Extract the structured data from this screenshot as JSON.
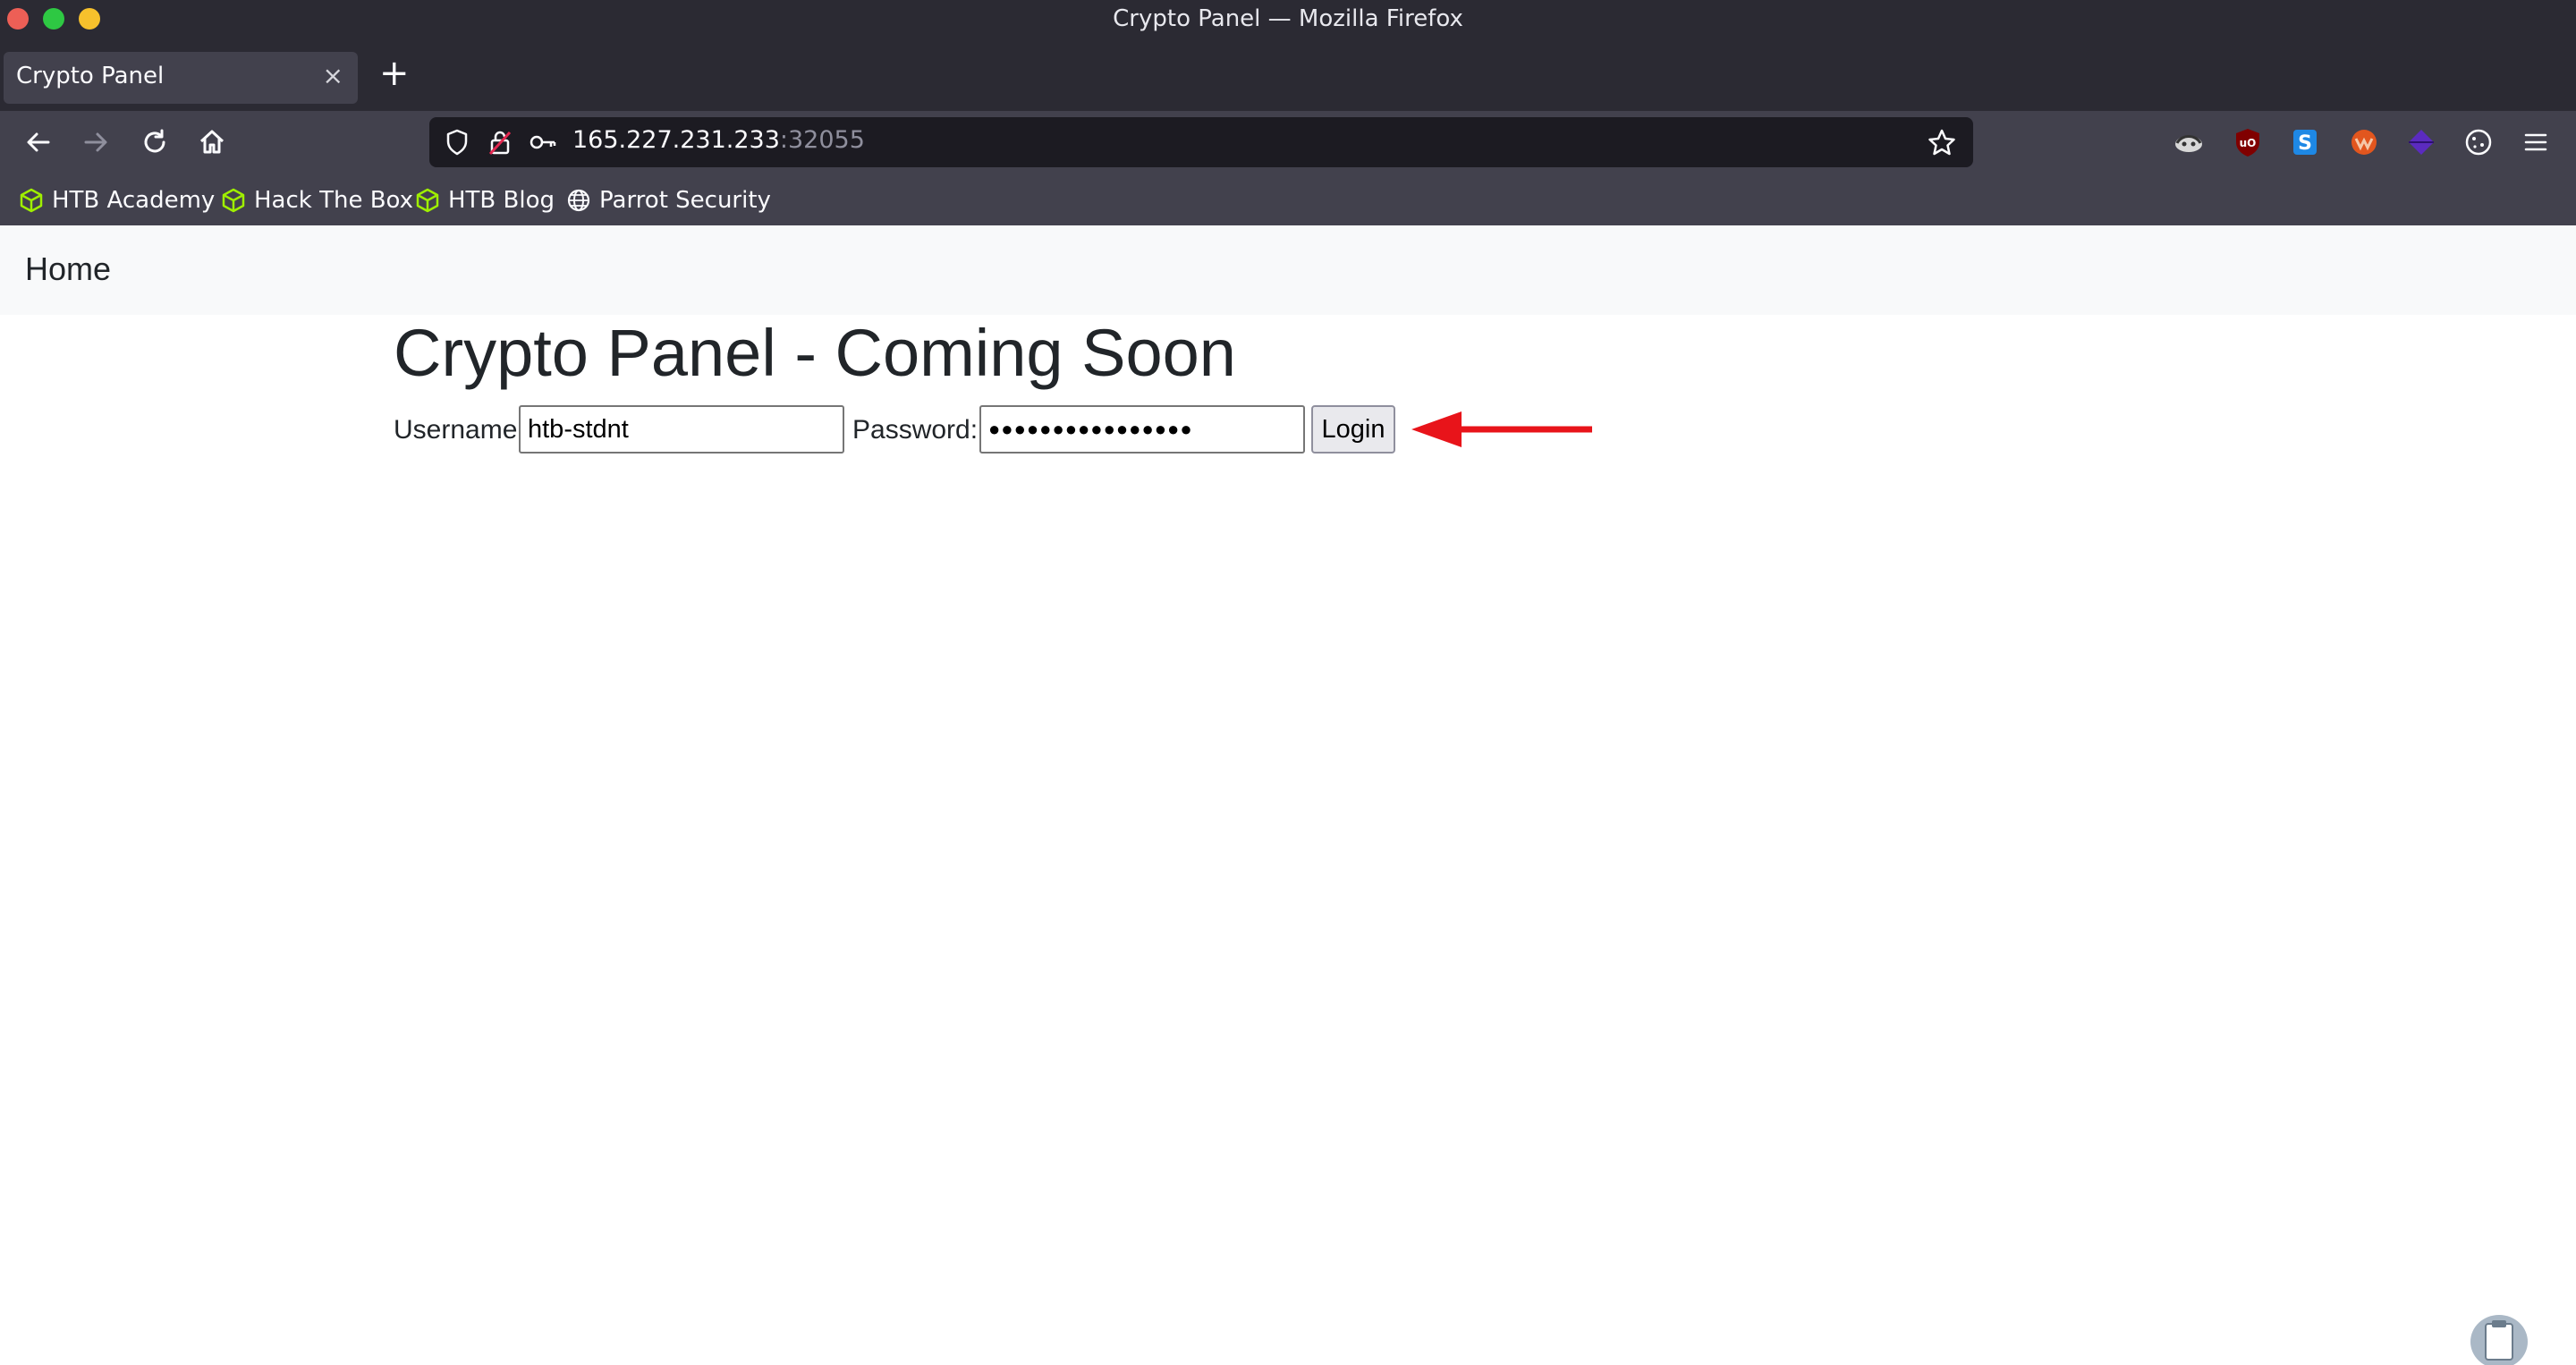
{
  "window": {
    "title": "Crypto Panel — Mozilla Firefox"
  },
  "tabs": [
    {
      "label": "Crypto Panel",
      "close": "×"
    }
  ],
  "new_tab": "+",
  "address_bar": {
    "host": "165.227.231.233",
    "port": ":32055"
  },
  "bookmarks": [
    {
      "label": "HTB Academy",
      "icon": "htb-cube-icon"
    },
    {
      "label": "Hack The Box",
      "icon": "htb-cube-icon"
    },
    {
      "label": "HTB Blog",
      "icon": "htb-cube-icon"
    },
    {
      "label": "Parrot Security",
      "icon": "globe-icon"
    }
  ],
  "extensions": [
    "foxyproxy-icon",
    "ublock-origin-icon",
    "s-extension-icon",
    "wappalyzer-icon",
    "purple-extension-icon",
    "cookie-editor-icon",
    "menu-icon"
  ],
  "page": {
    "nav_home": "Home",
    "heading": "Crypto Panel - Coming Soon",
    "username_label": "Username",
    "username_value": "htb-stdnt",
    "password_label": "Password:",
    "password_mask": "●●●●●●●●●●●●●●●●",
    "login_label": "Login"
  },
  "colors": {
    "chrome_dark": "#2b2a33",
    "toolbar": "#42414d",
    "url_field": "#1c1b22",
    "annotation_arrow": "#e8141a",
    "htb_green": "#9fef00"
  }
}
